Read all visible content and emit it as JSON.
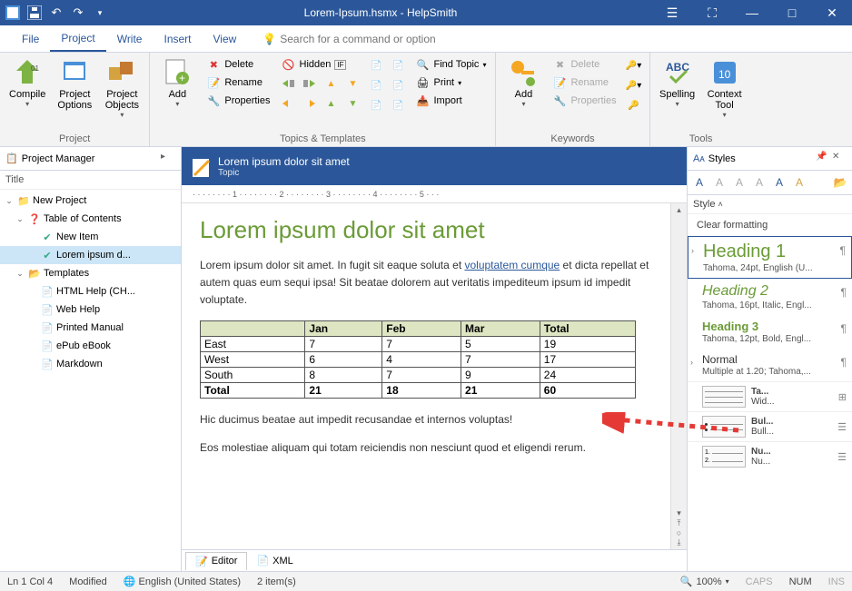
{
  "titlebar": {
    "title": "Lorem-Ipsum.hsmx - HelpSmith"
  },
  "menu": {
    "file": "File",
    "project": "Project",
    "write": "Write",
    "insert": "Insert",
    "view": "View",
    "search_placeholder": "Search for a command or option"
  },
  "ribbon": {
    "compile": "Compile",
    "project_options": "Project\nOptions",
    "project_objects": "Project\nObjects",
    "group_project": "Project",
    "add": "Add",
    "delete": "Delete",
    "rename": "Rename",
    "properties": "Properties",
    "hidden": "Hidden",
    "find_topic": "Find Topic",
    "print": "Print",
    "import": "Import",
    "group_topics": "Topics & Templates",
    "kw_add": "Add",
    "kw_delete": "Delete",
    "kw_rename": "Rename",
    "kw_properties": "Properties",
    "group_keywords": "Keywords",
    "spelling": "Spelling",
    "context_tool": "Context\nTool",
    "group_tools": "Tools"
  },
  "project_manager": {
    "title": "Project Manager",
    "col_title": "Title",
    "root": "New Project",
    "toc": "Table of Contents",
    "new_item": "New Item",
    "lorem": "Lorem ipsum d...",
    "templates": "Templates",
    "t_html": "HTML Help (CH...",
    "t_web": "Web Help",
    "t_manual": "Printed Manual",
    "t_epub": "ePub eBook",
    "t_md": "Markdown"
  },
  "doc": {
    "title": "Lorem ipsum dolor sit amet",
    "subtitle": "Topic",
    "heading": "Lorem ipsum dolor sit amet",
    "p1a": "Lorem ipsum dolor sit amet. In fugit sit eaque soluta et ",
    "p1_link": "voluptatem cumque",
    "p1b": " et dicta repellat et autem quas eum sequi ipsa! Sit beatae dolorem aut veritatis impediteum ipsum id impedit voluptate.",
    "p2": "Hic ducimus beatae aut impedit recusandae et internos voluptas!",
    "p3": "Eos molestiae aliquam qui totam reiciendis non nesciunt quod et eligendi rerum.",
    "table": {
      "headers": [
        "",
        "Jan",
        "Feb",
        "Mar",
        "Total"
      ],
      "rows": [
        [
          "East",
          "7",
          "7",
          "5",
          "19"
        ],
        [
          "West",
          "6",
          "4",
          "7",
          "17"
        ],
        [
          "South",
          "8",
          "7",
          "9",
          "24"
        ]
      ],
      "total": [
        "Total",
        "21",
        "18",
        "21",
        "60"
      ]
    }
  },
  "editor_tabs": {
    "editor": "Editor",
    "xml": "XML"
  },
  "styles": {
    "title": "Styles",
    "subhead": "Style",
    "clear": "Clear formatting",
    "items": [
      {
        "name": "Heading 1",
        "desc": "Tahoma, 24pt, English (U..."
      },
      {
        "name": "Heading 2",
        "desc": "Tahoma, 16pt, Italic, Engl..."
      },
      {
        "name": "Heading 3",
        "desc": "Tahoma, 12pt, Bold, Engl..."
      },
      {
        "name": "Normal",
        "desc": "Multiple at 1.20; Tahoma,..."
      }
    ],
    "thumbs": [
      {
        "name": "Ta...",
        "desc": "Wid..."
      },
      {
        "name": "Bul...",
        "desc": "Bull..."
      },
      {
        "name": "Nu...",
        "desc": "Nu..."
      }
    ]
  },
  "status": {
    "pos": "Ln 1 Col 4",
    "modified": "Modified",
    "lang": "English (United States)",
    "items": "2 item(s)",
    "zoom": "100%",
    "caps": "CAPS",
    "num": "NUM",
    "ins": "INS"
  }
}
